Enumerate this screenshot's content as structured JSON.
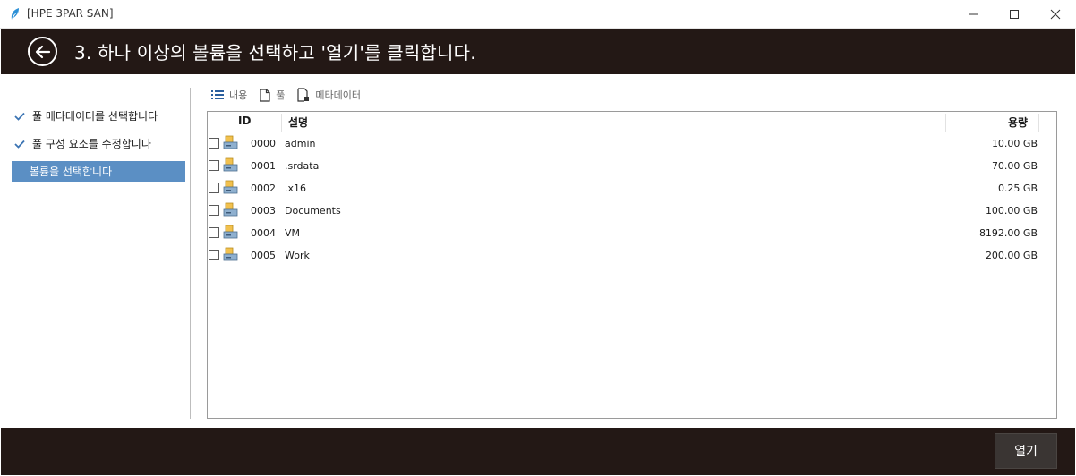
{
  "window": {
    "title": "[HPE 3PAR SAN]"
  },
  "header": {
    "title": "3. 하나 이상의 볼륨을 선택하고 '열기'를 클릭합니다."
  },
  "steps": [
    {
      "label": "풀 메타데이터를 선택합니다",
      "done": true
    },
    {
      "label": "풀 구성 요소를 수정합니다",
      "done": true
    },
    {
      "label": "볼륨을 선택합니다",
      "active": true
    }
  ],
  "tabs": [
    {
      "label": "내용",
      "icon": "list-icon"
    },
    {
      "label": "풀",
      "icon": "document-icon"
    },
    {
      "label": "메타데이터",
      "icon": "metadata-icon"
    }
  ],
  "table": {
    "columns": {
      "id": "ID",
      "desc": "설명",
      "size": "용량"
    },
    "rows": [
      {
        "id": "0000",
        "desc": "admin",
        "size": "10.00 GB"
      },
      {
        "id": "0001",
        "desc": ".srdata",
        "size": "70.00 GB"
      },
      {
        "id": "0002",
        "desc": ".x16",
        "size": "0.25 GB"
      },
      {
        "id": "0003",
        "desc": "Documents",
        "size": "100.00 GB"
      },
      {
        "id": "0004",
        "desc": "VM",
        "size": "8192.00 GB"
      },
      {
        "id": "0005",
        "desc": "Work",
        "size": "200.00 GB"
      }
    ]
  },
  "footer": {
    "open_label": "열기"
  },
  "colors": {
    "dark_bar": "#231815",
    "active_step": "#5b8fc4"
  }
}
